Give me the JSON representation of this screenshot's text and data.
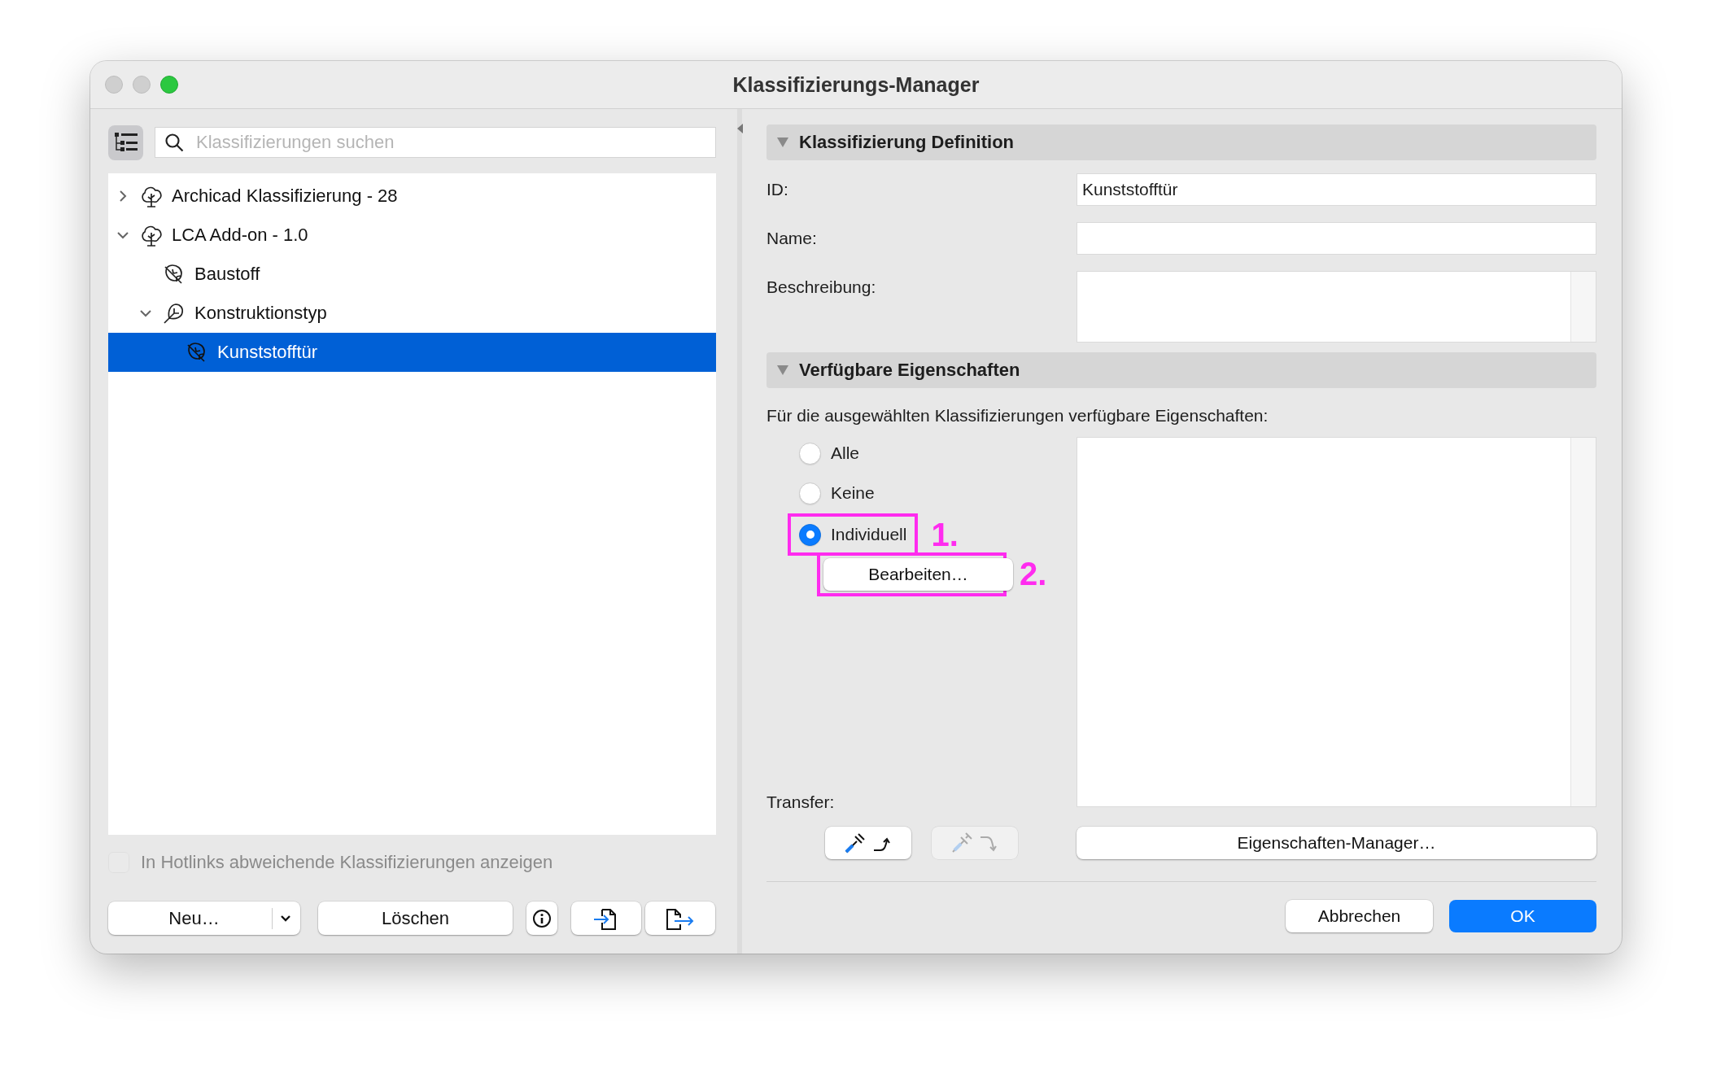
{
  "window": {
    "title": "Klassifizierungs-Manager"
  },
  "search": {
    "placeholder": "Klassifizierungen suchen"
  },
  "tree": [
    {
      "label": "Archicad Klassifizierung - 28",
      "kind": "system",
      "expanded": false,
      "selected": false
    },
    {
      "label": "LCA Add-on - 1.0",
      "kind": "system",
      "expanded": true,
      "selected": false,
      "children": [
        {
          "label": "Baustoff",
          "kind": "leaf",
          "selected": false
        },
        {
          "label": "Konstruktionstyp",
          "kind": "branch",
          "expanded": true,
          "selected": false,
          "children": [
            {
              "label": "Kunststofftür",
              "kind": "leaf",
              "selected": true
            }
          ]
        }
      ]
    }
  ],
  "hotlinks_checkbox": {
    "label": "In Hotlinks abweichende Klassifizierungen anzeigen",
    "checked": false,
    "disabled": true
  },
  "left_buttons": [
    {
      "kind": "split",
      "label": "Neu…"
    },
    {
      "kind": "text",
      "label": "Löschen"
    },
    {
      "kind": "info"
    },
    {
      "kind": "import"
    },
    {
      "kind": "export"
    }
  ],
  "definition": {
    "title": "Klassifizierung Definition",
    "expanded": true,
    "fields": [
      {
        "kind": "line",
        "label": "ID:",
        "value": "Kunststofftür"
      },
      {
        "kind": "line",
        "label": "Name:"
      },
      {
        "kind": "area",
        "label": "Beschreibung:"
      }
    ]
  },
  "properties": {
    "title": "Verfügbare Eigenschaften",
    "expanded": true,
    "caption": "Für die ausgewählten Klassifizierungen verfügbare Eigenschaften:",
    "options": [
      {
        "label": "Alle",
        "selected": false
      },
      {
        "label": "Keine",
        "selected": false
      },
      {
        "label": "Individuell",
        "selected": true
      }
    ],
    "edit_button": "Bearbeiten…",
    "transfer_label": "Transfer:",
    "transfer_buttons": [
      {
        "kind": "pick",
        "disabled": false
      },
      {
        "kind": "inject",
        "disabled": true
      }
    ],
    "manager_button": "Eigenschaften-Manager…"
  },
  "annotations": [
    {
      "kind": "option",
      "label": "1."
    },
    {
      "kind": "edit",
      "label": "2."
    }
  ],
  "dialog_buttons": [
    {
      "kind": "normal",
      "label": "Abbrechen"
    },
    {
      "kind": "primary",
      "label": "OK"
    }
  ]
}
